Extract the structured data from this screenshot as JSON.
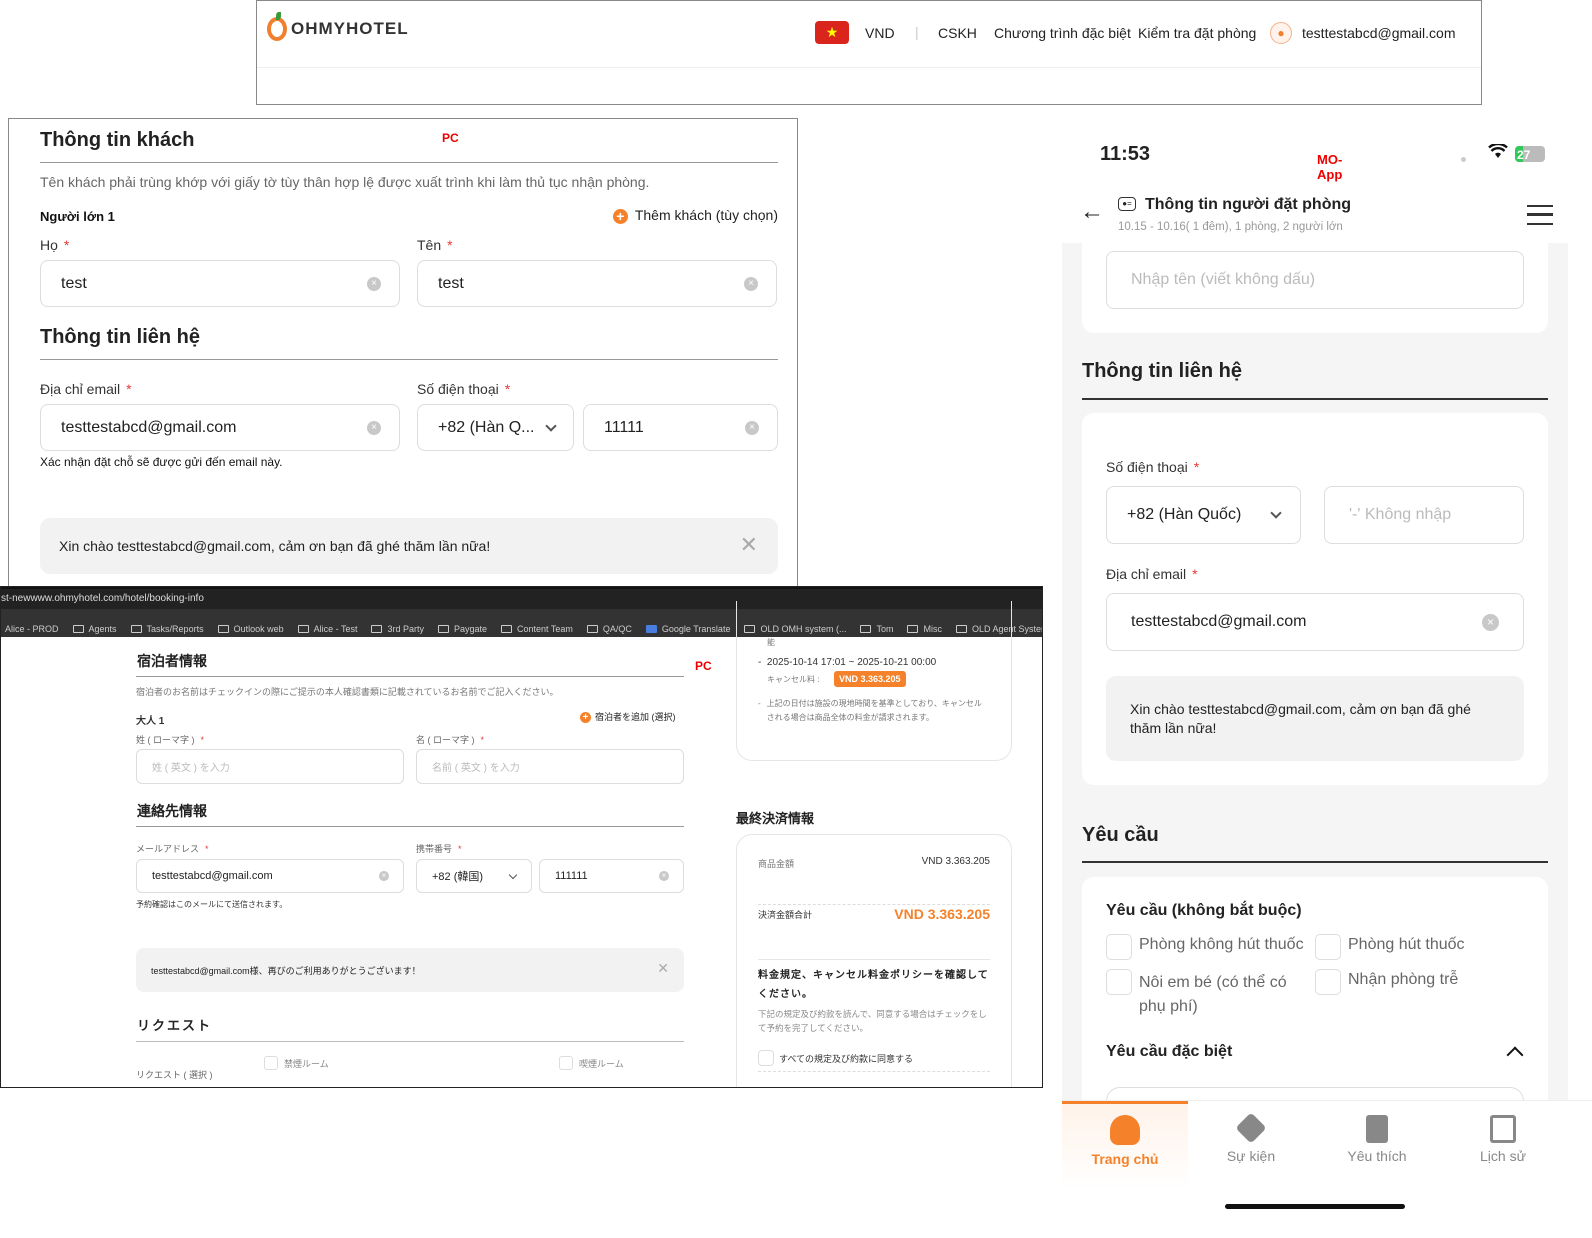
{
  "header": {
    "logo_text": "OHMYHOTEL",
    "currency": "VND",
    "separator": "|",
    "nav": [
      "CSKH",
      "Chương trình đặc biệt",
      "Kiểm tra đặt phòng"
    ],
    "user_email": "testtestabcd@gmail.com"
  },
  "pc_vi": {
    "tag": "PC",
    "guest_title": "Thông tin khách",
    "guest_desc": "Tên khách phải trùng khớp với giấy tờ tùy thân hợp lệ được xuất trình khi làm thủ tục nhận phòng.",
    "adult_label": "Người lớn 1",
    "add_guest": "Thêm khách (tùy chọn)",
    "required_mark": "*",
    "last_name_label": "Họ",
    "last_name_value": "test",
    "first_name_label": "Tên",
    "first_name_value": "test",
    "contact_title": "Thông tin liên hệ",
    "email_label": "Địa chỉ email",
    "email_value": "testtestabcd@gmail.com",
    "phone_label": "Số điện thoại",
    "country_code": "+82 (Hàn Q...",
    "phone_value": "11111",
    "email_note": "Xác nhận đặt chỗ sẽ được gửi đến email này.",
    "welcome": "Xin chào testtestabcd@gmail.com, cảm ơn bạn đã ghé thăm lần nữa!"
  },
  "browser": {
    "url": "st-newwww.ohmyhotel.com/hotel/booking-info",
    "bookmarks": [
      "Alice - PROD",
      "Agents",
      "Tasks/Reports",
      "Outlook web",
      "Alice - Test",
      "3rd Party",
      "Paygate",
      "Content Team",
      "QA/QC",
      "Google Translate",
      "OLD OMH system (...",
      "Tom",
      "Misc",
      "OLD Agent System"
    ]
  },
  "pc_ja": {
    "tag": "PC",
    "guest_title": "宿泊者情報",
    "guest_desc": "宿泊者のお名前はチェックインの際にご提示の本人確認書類に記載されているお名前でご記入ください。",
    "adult_label": "大人 1",
    "add_guest": "宿泊者を追加 (選択)",
    "required_mark": "*",
    "last_name_label": "姓 ( ローマ字 )",
    "last_name_placeholder": "姓 ( 英文 ) を入力",
    "first_name_label": "名 ( ローマ字 )",
    "first_name_placeholder": "名前 ( 英文 ) を入力",
    "contact_title": "連絡先情報",
    "email_label": "メールアドレス",
    "email_value": "testtestabcd@gmail.com",
    "phone_label": "携帯番号",
    "country_code": "+82 (韓国)",
    "phone_value": "111111",
    "email_note": "予約確認はこのメールにて送信されます。",
    "welcome": "testtestabcd@gmail.com様、再びのご利用ありがとうございます！",
    "request_title": "リクエスト",
    "request_label": "リクエスト ( 選択 )",
    "request_options": [
      "禁煙ルーム",
      "喫煙ルーム"
    ],
    "cancel": {
      "cut_text": "能",
      "period": "2025-10-14 17:01 ~ 2025-10-21 00:00",
      "fee_label": "キャンセル料 :",
      "fee_value": "VND 3.363.205",
      "note": "上記の日付は施設の現地時間を基準としており、キャンセルされる場合は商品全体の料金が請求されます。"
    },
    "payment_title": "最終決済情報",
    "product_amount_label": "商品金額",
    "product_amount_value": "VND 3.363.205",
    "total_label": "決済金額合計",
    "total_value": "VND 3.363.205",
    "policy_title": "料金規定、キャンセル料金ポリシーを確認してください。",
    "policy_desc": "下記の規定及び約款を読んで、同意する場合はチェックをして予約を完了してください。",
    "agree_all": "すべての規定及び約款に同意する"
  },
  "mobile": {
    "time": "11:53",
    "tag": "MO-App",
    "battery": "27",
    "title": "Thông tin người đặt phòng",
    "subtitle": "10.15 - 10.16( 1 đêm), 1 phòng, 2 người lớn",
    "name_placeholder": "Nhập tên (viết không dấu)",
    "contact_title": "Thông tin liên hệ",
    "required_mark": "*",
    "phone_label": "Số điện thoại",
    "country_code": "+82 (Hàn Quốc)",
    "phone_placeholder": "'-' Không nhập",
    "email_label": "Địa chỉ email",
    "email_value": "testtestabcd@gmail.com",
    "welcome": "Xin chào testtestabcd@gmail.com, cảm ơn bạn đã ghé thăm lần nữa!",
    "request_title": "Yêu cầu",
    "request_optional": "Yêu cầu (không bắt buộc)",
    "request_options": [
      "Phòng không hút thuốc",
      "Phòng hút thuốc",
      "Nôi em bé (có thể có phụ phí)",
      "Nhận phòng trễ"
    ],
    "special_request": "Yêu cầu đặc biệt",
    "tabs": [
      "Trang chủ",
      "Sự kiện",
      "Yêu thích",
      "Lịch sử"
    ],
    "accent": "#f5822a"
  }
}
